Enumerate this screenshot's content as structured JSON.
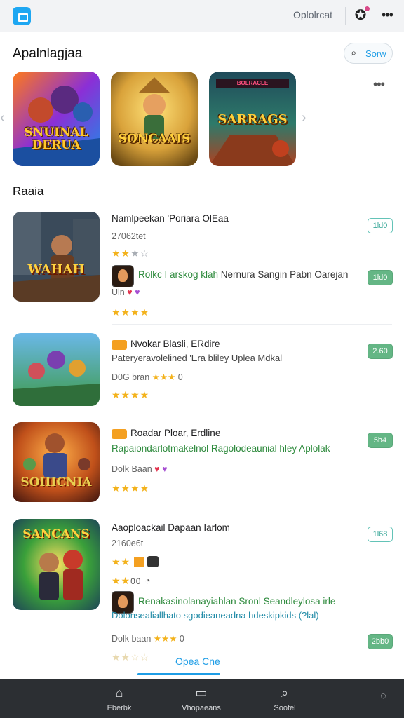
{
  "header": {
    "top_link": "Oplolrcat",
    "icons": [
      "app-logo-icon",
      "profile-icon",
      "more-icon"
    ],
    "notification_dot_color": "#d84b8a"
  },
  "featured": {
    "title": "Apalnlagjaa",
    "see_all_label": "Sorw",
    "cards": [
      {
        "title": "SNUINAL DERUA"
      },
      {
        "title": "SONCAAIS"
      },
      {
        "title": "SARRAGS",
        "badge": "BOLRACLE"
      }
    ]
  },
  "list": {
    "title": "Raaia",
    "items": [
      {
        "thumb_title": "WAHAH",
        "title": "Namlpeekan 'Poriara OlEaa",
        "subtitle": "27062tet",
        "stars": "★★",
        "stars_off": "★☆",
        "green_text": "Rolkc I arskog klah",
        "green_text_dark": " Nernura Sangin Pabn Oarejan",
        "meta": "Uln",
        "stars2": "★★★★",
        "pill": "1ld0",
        "pill_style": "outline"
      },
      {
        "title": "Nvokar Blasli, ERdire",
        "subtitle": "Pateryeravolelined 'Era bliley Uplea Mdkal",
        "meta": "D0G bran",
        "meta_stars": "★★★",
        "meta_end": "0",
        "stars2": "★★★★",
        "pill": "2.60",
        "pill_style": "filled"
      },
      {
        "thumb_title": "SOIIICNIA",
        "title": "Roadar Ploar, Erdline",
        "green_text": "Rapaiondarlotmakelnol Ragolodeaunial hley Aplolak",
        "meta": "Dolk Baan",
        "stars2": "★★★★",
        "pill": "5b4",
        "pill_style": "filled"
      },
      {
        "thumb_title": "SANCANS",
        "title": "Aaoploackail Dapaan Iarlom",
        "subtitle": "2160e6t",
        "stars_a": "★★",
        "stars_b": "★★",
        "stars_b_text": "00",
        "green_text": "Renakasinolanayiahlan",
        "green_text_dark": " Sronl Seandleylosa irle",
        "teal_text": "Dolonsealiallhato sgodieaneadna hdeskipkids (?lal)",
        "meta": "Dolk baan",
        "meta_stars": "★★★",
        "meta_end": "0",
        "pill": "1l68",
        "pill_style": "outline",
        "pill2": "2bb0",
        "pill2_style": "filled"
      }
    ],
    "open_link": "Opea Cne"
  },
  "bottom_nav": {
    "items": [
      {
        "label": "Eberbk",
        "icon": "home-icon"
      },
      {
        "label": "Vhopaeans",
        "icon": "library-icon"
      },
      {
        "label": "Sootel",
        "icon": "search-icon"
      }
    ]
  },
  "colors": {
    "accent": "#1e9de6",
    "green": "#2d8a3c",
    "star": "#f3b21c",
    "nav_bg": "#2c2f33"
  }
}
